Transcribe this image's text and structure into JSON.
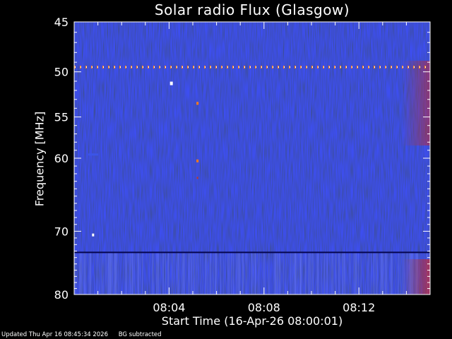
{
  "chart_data": {
    "type": "heatmap",
    "title": "Solar radio Flux (Glasgow)",
    "xlabel": "Start Time (16-Apr-26 08:00:01)",
    "ylabel": "Frequency [MHz]",
    "x_ticks": [
      "08:04",
      "08:08",
      "08:12"
    ],
    "x_tick_minutes": [
      4,
      8,
      12
    ],
    "xlim_minutes": [
      0,
      15
    ],
    "y_ticks": [
      45,
      50,
      55,
      60,
      70,
      80
    ],
    "ylim": [
      45,
      80
    ],
    "y_scale": "log",
    "colormap": [
      "#07077a",
      "#1b24c4",
      "#3b55e8",
      "#c0392b",
      "#ff7a1a",
      "#ffffff"
    ],
    "features": [
      {
        "name": "50 MHz interference",
        "freq_mhz": 49.5,
        "time_minutes": [
          0,
          15
        ],
        "intensity": "high"
      },
      {
        "name": "band edge",
        "freq_mhz": 73.2,
        "time_minutes": [
          0,
          15
        ],
        "intensity": "low"
      }
    ]
  },
  "footer": {
    "updated": "Updated Thu Apr 16 08:45:34 2026",
    "note": "BG subtracted"
  },
  "colors": {
    "background": "#000000",
    "plot_base": "#10109a",
    "axis": "#ffffff"
  }
}
